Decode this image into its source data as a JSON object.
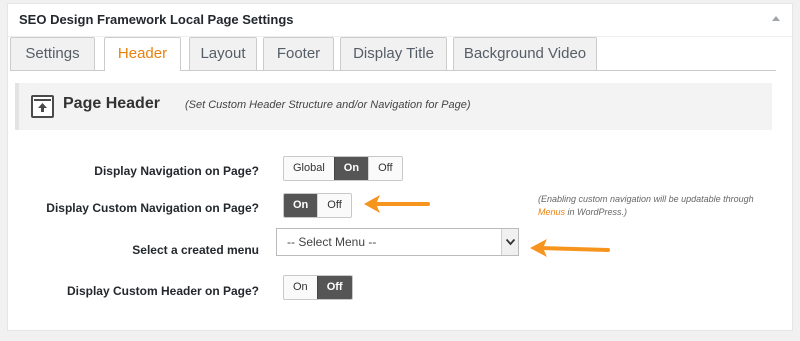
{
  "metabox": {
    "title": "SEO Design Framework Local Page Settings"
  },
  "tabs": [
    {
      "label": "Settings"
    },
    {
      "label": "Header"
    },
    {
      "label": "Layout"
    },
    {
      "label": "Footer"
    },
    {
      "label": "Display Title"
    },
    {
      "label": "Background Video"
    }
  ],
  "active_tab": "Header",
  "page_header": {
    "title": "Page Header",
    "subtitle": "(Set Custom Header Structure and/or Navigation for Page)",
    "icon": "page-header-icon"
  },
  "rows": {
    "display_navigation": {
      "label": "Display Navigation on Page?",
      "options": [
        "Global",
        "On",
        "Off"
      ],
      "selected": "On"
    },
    "display_custom_navigation": {
      "label": "Display Custom Navigation on Page?",
      "options": [
        "On",
        "Off"
      ],
      "selected": "On"
    },
    "select_menu": {
      "label": "Select a created menu",
      "value": "-- Select Menu --"
    },
    "display_custom_header": {
      "label": "Display Custom Header on Page?",
      "options": [
        "On",
        "Off"
      ],
      "selected": "Off"
    }
  },
  "help_note": {
    "before": "(Enabling custom navigation will be updatable through",
    "link": "Menus",
    "after": "in WordPress.)"
  },
  "colors": {
    "accent": "#e6820e",
    "selected_segment": "#555555",
    "annotation_arrow": "#f7941d"
  }
}
